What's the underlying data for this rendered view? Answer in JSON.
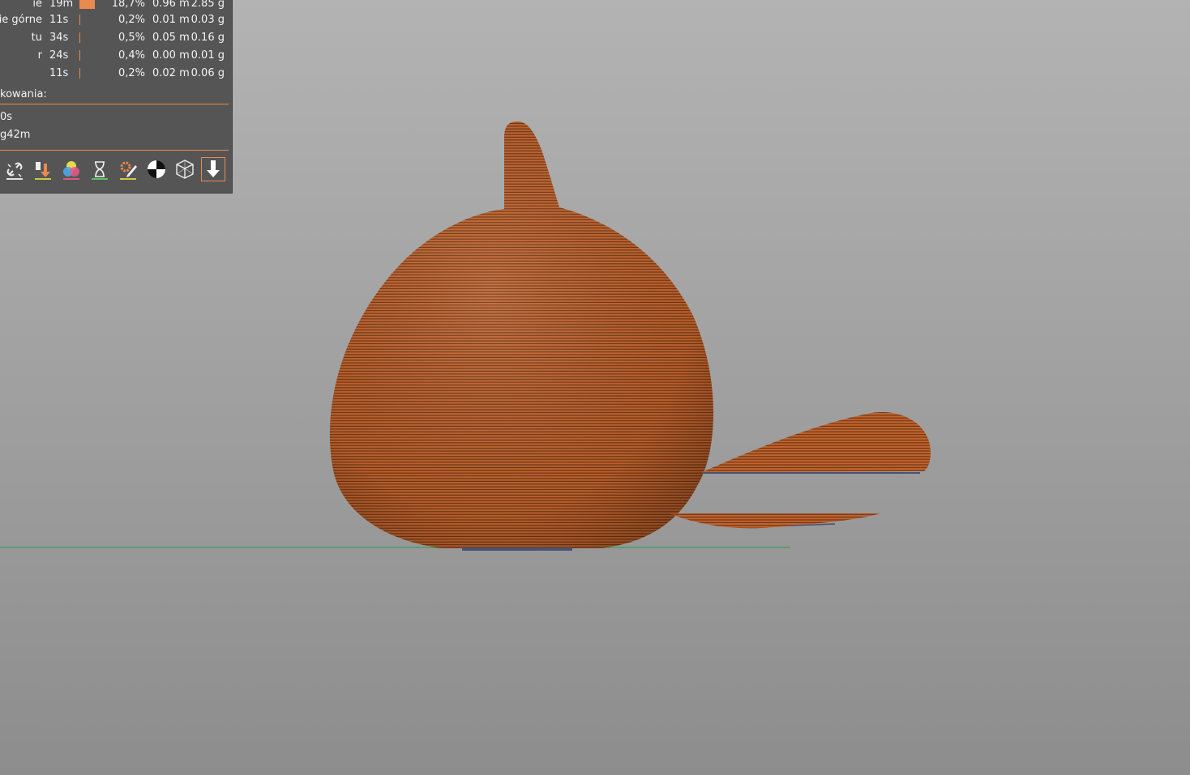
{
  "legend": {
    "rows": [
      {
        "name": "ie",
        "time": "19m",
        "bar": 0.187,
        "pct": "18,7%",
        "len": "0.96 m",
        "wt": "2.85 g"
      },
      {
        "name": "ie górne",
        "time": "11s",
        "bar": 0.002,
        "pct": "0,2%",
        "len": "0.01 m",
        "wt": "0.03 g"
      },
      {
        "name": "tu",
        "time": "34s",
        "bar": 0.005,
        "pct": "0,5%",
        "len": "0.05 m",
        "wt": "0.16 g"
      },
      {
        "name": "r",
        "time": "24s",
        "bar": 0.004,
        "pct": "0,4%",
        "len": "0.00 m",
        "wt": "0.01 g"
      },
      {
        "name": "",
        "time": "11s",
        "bar": 0.002,
        "pct": "0,2%",
        "len": "0.02 m",
        "wt": "0.06 g"
      }
    ],
    "section_label": "kowania:",
    "line1": "0s",
    "line2": "g42m"
  },
  "toolbar": {
    "buttons": [
      {
        "icon": "unlink-icon",
        "color": "#e0e0e0"
      },
      {
        "icon": "retract-arrow-icon",
        "color": "#c9c94a"
      },
      {
        "icon": "color-circles-icon",
        "color": "#d85a7a"
      },
      {
        "icon": "hourglass-icon",
        "color": "#5ac35a"
      },
      {
        "icon": "gear-pencil-icon",
        "color": "#d4c24a"
      },
      {
        "icon": "seam-marker-icon",
        "color": ""
      },
      {
        "icon": "cube-wireframe-icon",
        "color": ""
      },
      {
        "icon": "download-arrow-icon",
        "color": ""
      }
    ]
  },
  "colors": {
    "accent": "#e98a4e",
    "panel": "#555555",
    "model_filament": "#c0632f",
    "bed_line": "#3f9a56"
  }
}
